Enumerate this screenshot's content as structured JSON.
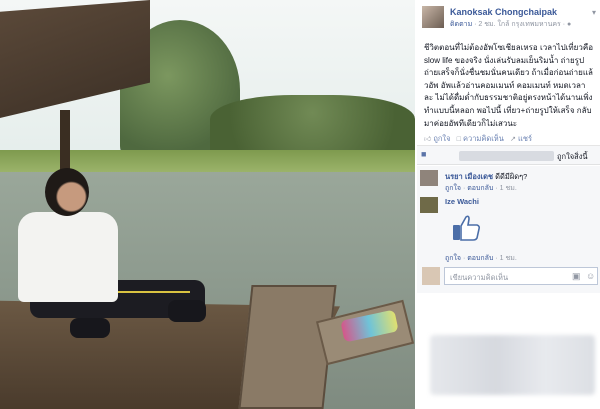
{
  "post": {
    "author": "Kanoksak Chongchaipak",
    "follow_label": "ติดตาม",
    "meta": " · 2 ชม. ใกล้ กรุงเทพมหานคร · ",
    "caption": "ชีวิตตอนที่ไม่ต้องอัพโซเชียลเหรอ เวลาไปเที่ยวคือ slow life ของจริง นั่งเล่นรับลมเย็นริมน้ำ ถ่ายรูปถ่ายเสร็จก็นั่งชื่นชมนั่นคนเดียว ถ้าเมื่อก่อนถ่ายแล้วอัพ อัพแล้วอ่านคอมเมนท์ คอมเมนท์ หมดเวลาละ ไม่ได้ดื่มด่ำกับธรรมชาติอยู่ตรงหน้าได้นานเพิ่งทำแบบนี้หลอก พอไปนี้ เที่ยว+ถ่ายรูปให้เสร็จ กลับมาค่อยอัพทีเดียวก็ไม่เสวนะ"
  },
  "actions": {
    "like": "ถูกใจ",
    "comment": "ความคิดเห็น",
    "share": "แชร์"
  },
  "likebar": {
    "suffix": "ถูกใจสิ่งนี้"
  },
  "comments": [
    {
      "name": "นรยา เมืองเดช",
      "text": " ดีดีมีผิดๆ?",
      "like": "ถูกใจ",
      "reply": "ตอบกลับ",
      "time": " · 1 ชม."
    },
    {
      "name": "Ize Wachi",
      "text": "",
      "like": "ถูกใจ",
      "reply": "ตอบกลับ",
      "time": " · 1 ชม."
    }
  ],
  "composer": {
    "placeholder": "เขียนความคิดเห็น"
  },
  "icons": {
    "thumb": "thumbs-up-icon",
    "comment": "comment-icon",
    "share": "share-icon",
    "camera": "camera-icon",
    "smiley": "smiley-icon",
    "chevron": "chevron-down-icon"
  },
  "colors": {
    "link": "#3b5998",
    "muted": "#9197a3",
    "like_sticker": "#4b6ea8"
  }
}
